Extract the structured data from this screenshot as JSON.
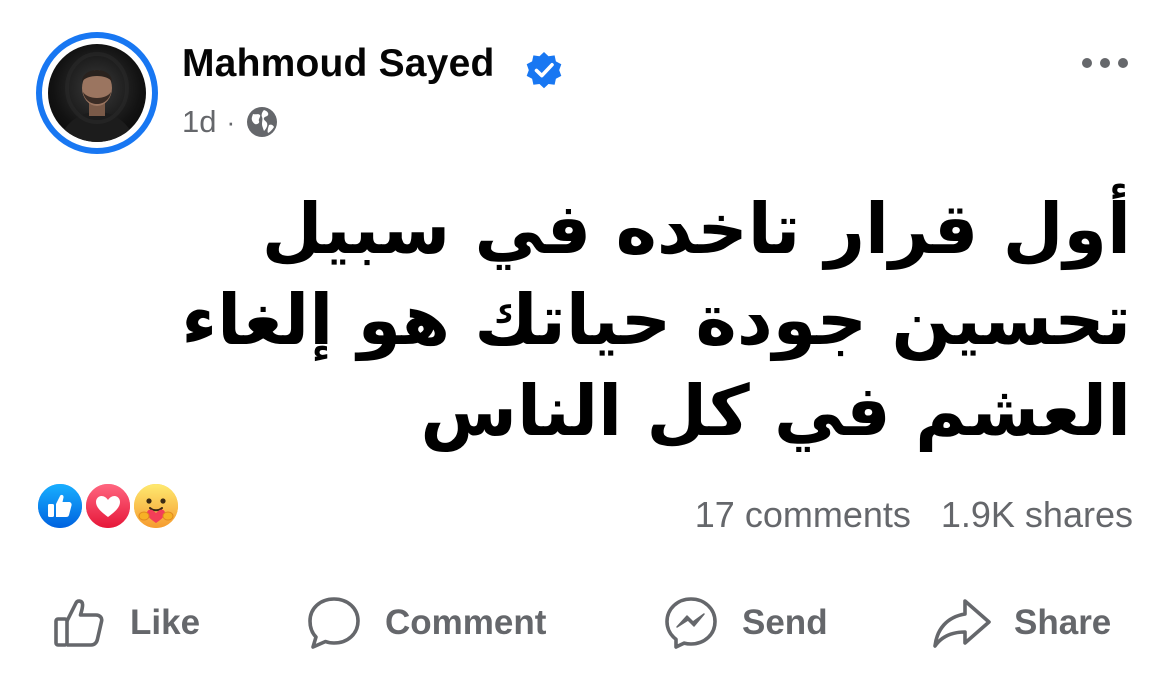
{
  "author": {
    "name": "Mahmoud Sayed",
    "verified": true,
    "timestamp": "1d",
    "separator": "·",
    "audience_icon": "globe-icon"
  },
  "post": {
    "text": "أول قرار تاخده في سبيل تحسين جودة حياتك هو إلغاء العشم في كل الناس"
  },
  "reactions": {
    "icons": [
      "like-reaction-icon",
      "love-reaction-icon",
      "care-reaction-icon"
    ],
    "comments": "17 comments",
    "shares": "1.9K shares"
  },
  "actions": {
    "like": "Like",
    "comment": "Comment",
    "send": "Send",
    "share": "Share"
  },
  "colors": {
    "brand": "#1877f2",
    "secondary_text": "#65676b",
    "love": "#f33e58",
    "care": "#f7b125"
  }
}
